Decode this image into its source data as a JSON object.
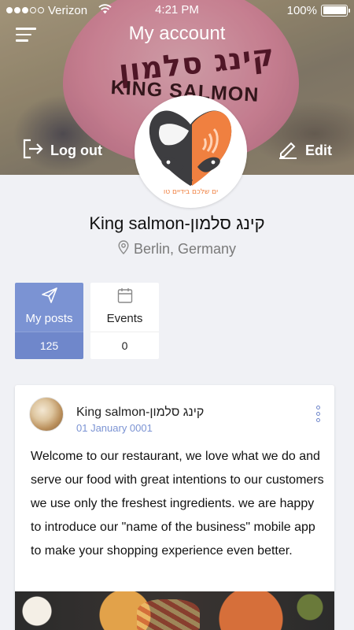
{
  "status_bar": {
    "carrier": "Verizon",
    "time": "4:21 PM",
    "battery": "100%",
    "signal_bars_filled": 3,
    "signal_bars_total": 5,
    "battery_level": 1.0
  },
  "header": {
    "title": "My account",
    "logout_label": "Log out",
    "edit_label": "Edit"
  },
  "cover": {
    "hebrew_text": "קינג סלמון",
    "english_text": "KING SALMON"
  },
  "avatar_logo": {
    "hebrew_text": "קינג סלמון",
    "english_text": "KING SALMON",
    "tagline": "ים שלכם בידיים טו"
  },
  "profile": {
    "name": "King salmon-קינג סלמון",
    "location": "Berlin, Germany"
  },
  "stats": [
    {
      "label": "My posts",
      "value": "125",
      "active": true,
      "icon": "send-icon"
    },
    {
      "label": "Events",
      "value": "0",
      "active": false,
      "icon": "calendar-icon"
    }
  ],
  "post": {
    "author": "King salmon-קינג סלמון",
    "date": "01 January 0001",
    "text": "Welcome to our restaurant, we love what we do and serve our food with great intentions to our customers we use only the freshest ingredients. we are happy to introduce our \"name of the business\" mobile app to make your shopping experience even better."
  },
  "colors": {
    "accent": "#7b93d3",
    "accent_dark": "#6f87cb",
    "background": "#f0f1f5",
    "logo_orange": "#f08040",
    "logo_dark": "#3d3d40"
  }
}
